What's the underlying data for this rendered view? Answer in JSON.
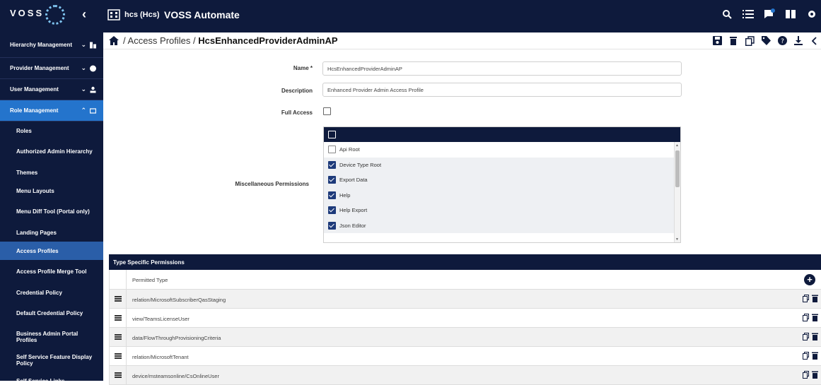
{
  "topbar": {
    "logo": "VOSS",
    "org_label": "hcs (Hcs)",
    "app_title": "VOSS Automate"
  },
  "sidebar": {
    "groups": [
      {
        "label": "Hierarchy Management"
      },
      {
        "label": "Provider Management"
      },
      {
        "label": "User Management"
      },
      {
        "label": "Role Management"
      }
    ],
    "items": [
      {
        "label": "Roles"
      },
      {
        "label": "Authorized Admin Hierarchy"
      },
      {
        "label": "Themes"
      },
      {
        "label": "Menu Layouts"
      },
      {
        "label": "Menu Diff Tool (Portal only)"
      },
      {
        "label": "Landing Pages"
      },
      {
        "label": "Access Profiles"
      },
      {
        "label": "Access Profile Merge Tool"
      },
      {
        "label": "Credential Policy"
      },
      {
        "label": "Default Credential Policy"
      },
      {
        "label": "Business Admin Portal Profiles"
      },
      {
        "label": "Self Service Feature Display Policy"
      },
      {
        "label": "Self Service Links"
      }
    ]
  },
  "breadcrumb": {
    "sep1": "/",
    "parent": "Access Profiles",
    "sep2": "/",
    "current": "HcsEnhancedProviderAdminAP"
  },
  "form": {
    "name_label": "Name *",
    "name_value": "HcsEnhancedProviderAdminAP",
    "description_label": "Description",
    "description_value": "Enhanced Provider Admin Access Profile",
    "full_access_label": "Full Access",
    "misc_label": "Miscellaneous Permissions",
    "misc_permissions": [
      {
        "label": "Api Root",
        "checked": false
      },
      {
        "label": "Device Type Root",
        "checked": true
      },
      {
        "label": "Export Data",
        "checked": true
      },
      {
        "label": "Help",
        "checked": true
      },
      {
        "label": "Help Export",
        "checked": true
      },
      {
        "label": "Json Editor",
        "checked": true
      }
    ]
  },
  "type_specific": {
    "title": "Type Specific Permissions",
    "column": "Permitted Type",
    "rows": [
      "relation/MicrosoftSubscriberQasStaging",
      "view/TeamsLicenseUser",
      "data/FlowThroughProvisioningCriteria",
      "relation/MicrosoftTenant",
      "device/msteamsonline/CsOnlineUser"
    ]
  },
  "colors": {
    "navy": "#0e1a3c",
    "active_group": "#2474cc",
    "selected_item": "#2a5ea8",
    "checkbox_on": "#1d3a7a"
  }
}
